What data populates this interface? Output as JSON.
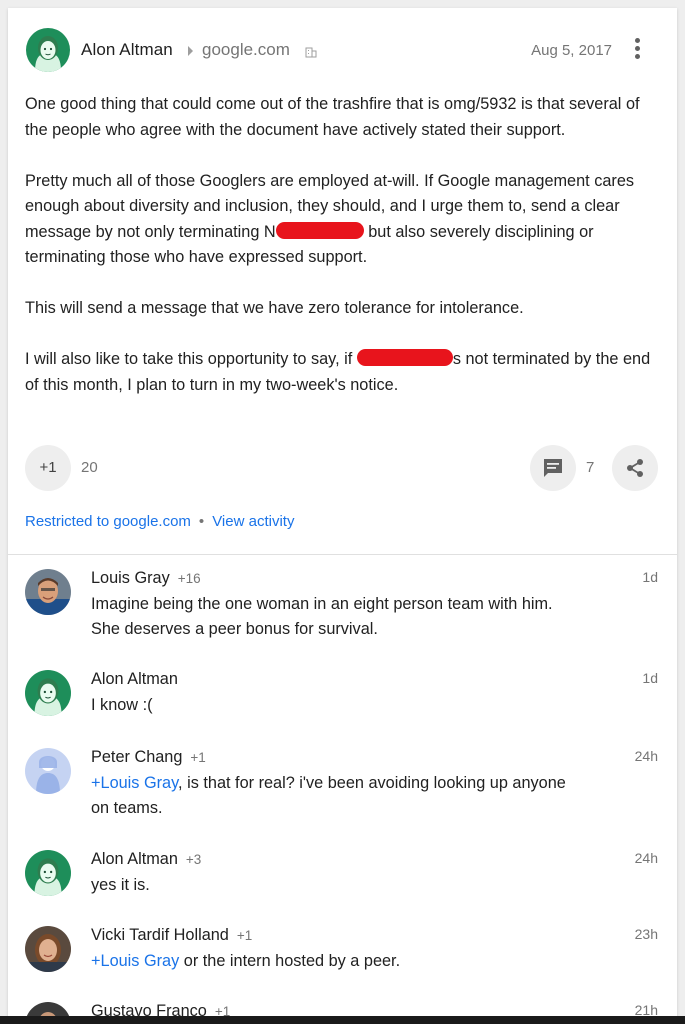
{
  "post": {
    "author": "Alon Altman",
    "domain": "google.com",
    "date": "Aug 5, 2017",
    "paragraphs": {
      "p1": "One good thing that could come out of the trashfire that is omg/5932 is that several of the people who agree with the document have actively stated their support.",
      "p2_before": "Pretty much all of those Googlers are employed at-will. If Google management cares enough about diversity and inclusion, they should, and I urge them to, send a clear message by not only terminating N",
      "p2_after": " but also severely disciplining or terminating those who have expressed support.",
      "p3": "This will send a message that we have zero tolerance for intolerance.",
      "p4_before": "I will also like to take this opportunity to say, if ",
      "p4_after": "s not terminated by the end of this month, I plan to turn in my two-week's notice."
    },
    "plus_one_label": "+1",
    "plus_one_count": "20",
    "comment_count": "7",
    "visibility_label": "Restricted to google.com",
    "view_activity_label": "View activity",
    "separator": "•"
  },
  "comments": [
    {
      "name": "Louis Gray",
      "plus": "+16",
      "time": "1d",
      "text": "Imagine being the one woman in an eight person team with him. She deserves a peer bonus for survival."
    },
    {
      "name": "Alon Altman",
      "plus": "",
      "time": "1d",
      "text": "I know :("
    },
    {
      "name": "Peter Chang",
      "plus": "+1",
      "time": "24h",
      "mention": "+Louis Gray",
      "text": ", is that for real? i've been avoiding looking up anyone on teams."
    },
    {
      "name": "Alon Altman",
      "plus": "+3",
      "time": "24h",
      "text": "yes it is."
    },
    {
      "name": "Vicki Tardif Holland",
      "plus": "+1",
      "time": "23h",
      "mention": "+Louis Gray",
      "text": " or the intern hosted by a peer."
    },
    {
      "name": "Gustavo Franco",
      "plus": "+1",
      "time": "21h",
      "text": ""
    }
  ],
  "colors": {
    "link": "#1a73e8",
    "redaction": "#e8141c",
    "avatar_green": "#0f9d58",
    "avatar_blue": "#9ab3e8"
  },
  "icons": [
    "arrow-right-icon",
    "building-icon",
    "more-vert-icon",
    "comment-icon",
    "share-icon"
  ]
}
